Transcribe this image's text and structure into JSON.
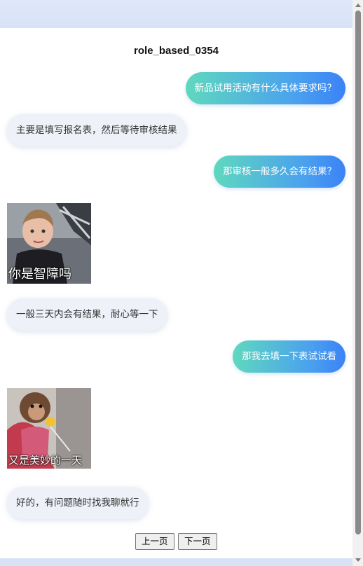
{
  "chat": {
    "title": "role_based_0354",
    "messages": [
      {
        "role": "user",
        "text": "新品试用活动有什么具体要求吗？"
      },
      {
        "role": "bot",
        "text": "主要是填写报名表，然后等待审核结果"
      },
      {
        "role": "user",
        "text": "那审核一般多久会有结果？"
      },
      {
        "role": "bot-sticker",
        "caption": "你是智障吗",
        "icon": "boy-sticker-image"
      },
      {
        "role": "bot",
        "text": "一般三天内会有结果，耐心等一下"
      },
      {
        "role": "user",
        "text": "那我去填一下表试试看"
      },
      {
        "role": "bot-sticker",
        "caption": "又是美妙的一天",
        "icon": "monkey-sticker-image"
      },
      {
        "role": "bot",
        "text": "好的，有问题随时找我聊就行"
      }
    ]
  },
  "pager": {
    "prev_label": "上一页",
    "next_label": "下一页"
  },
  "colors": {
    "user_bubble_start": "#5fd8be",
    "user_bubble_end": "#3b82f6",
    "bot_bubble": "#eef2f8",
    "page_background": "#dce6f7"
  }
}
